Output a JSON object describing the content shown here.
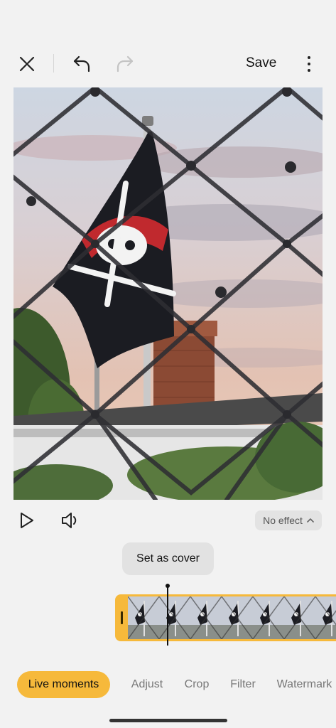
{
  "toolbar": {
    "save_label": "Save",
    "icons": [
      "close-icon",
      "undo-icon",
      "redo-icon",
      "more-vert-icon"
    ]
  },
  "photo": {
    "subject": "pirate-flag-behind-fence"
  },
  "controls": {
    "icons": [
      "play-icon",
      "speaker-icon"
    ],
    "effect_label": "No effect"
  },
  "tooltip": {
    "cover_label": "Set as cover"
  },
  "timeline": {
    "frame_count": 7
  },
  "tabs": [
    {
      "label": "Live moments",
      "active": true
    },
    {
      "label": "Adjust",
      "active": false
    },
    {
      "label": "Crop",
      "active": false
    },
    {
      "label": "Filter",
      "active": false
    },
    {
      "label": "Watermark",
      "active": false
    }
  ],
  "colors": {
    "accent": "#f6b93b",
    "background": "#f2f2f2"
  }
}
